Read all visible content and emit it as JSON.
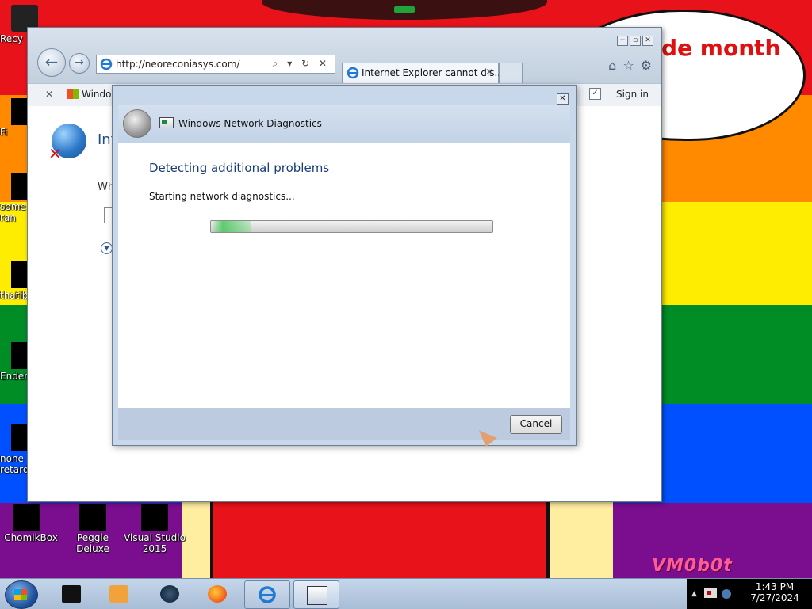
{
  "wallpaper": {
    "speech_line1": "de month",
    "speech_line2": "!",
    "watermark": "VM0b0t"
  },
  "desktop_icons": {
    "left": [
      {
        "label": "Recy",
        "name": "desktop-icon-recycle-bin"
      },
      {
        "label": "Fi",
        "name": "desktop-icon-fi"
      },
      {
        "label": "some ran",
        "name": "desktop-icon-some"
      },
      {
        "label": "thatib",
        "name": "desktop-icon-thatib"
      },
      {
        "label": "Ender",
        "name": "desktop-icon-ender"
      },
      {
        "label": "none retard",
        "name": "desktop-icon-none"
      }
    ],
    "bottom": [
      {
        "label": "ChomikBox",
        "name": "desktop-icon-chomikbox"
      },
      {
        "label": "Peggle Deluxe",
        "name": "desktop-icon-peggle-deluxe"
      },
      {
        "label": "Visual Studio 2015",
        "name": "desktop-icon-visual-studio-2015"
      }
    ]
  },
  "ie": {
    "address_url": "http://neoreconiasys.com/",
    "address_tools": "⌕ ▾ ↻ ✕",
    "tab_label": "Internet Explorer cannot dis...",
    "tab_close": "✕",
    "favbar_close": "✕",
    "favbar_link": "Windo",
    "sign_in": "Sign in",
    "page_heading": "Int",
    "page_question": "Wh"
  },
  "dialog": {
    "title": "Windows Network Diagnostics",
    "heading": "Detecting additional problems",
    "status": "Starting network diagnostics...",
    "cancel_label": "Cancel",
    "progress_fraction": 0.14,
    "close_glyph": "✕"
  },
  "taskbar": {
    "time": "1:43 PM",
    "date": "7/27/2024"
  }
}
